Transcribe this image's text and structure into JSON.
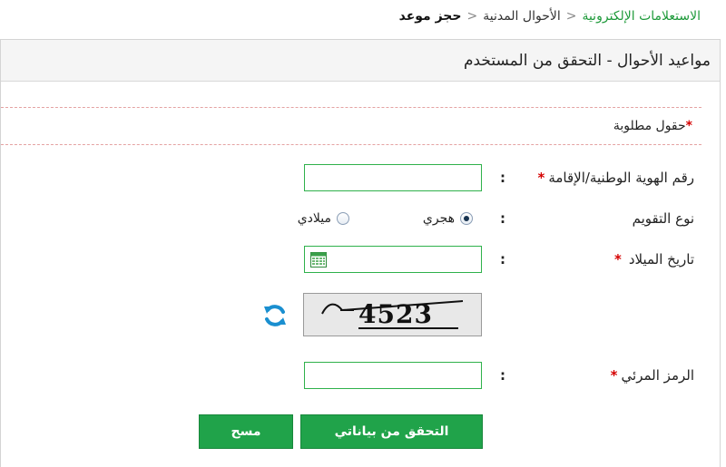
{
  "breadcrumb": {
    "items": [
      "الاستعلامات الإلكترونية",
      "الأحوال المدنية",
      "حجز موعد"
    ]
  },
  "panel": {
    "title": "مواعيد الأحوال - التحقق من المستخدم"
  },
  "required_note": {
    "star": "*",
    "text": "حقول مطلوبة"
  },
  "form": {
    "id_label": "رقم الهوية الوطنية/الإقامة",
    "calendar_label": "نوع التقويم",
    "calendar_options": [
      "هجري",
      "ميلادي"
    ],
    "calendar_selected": "هجري",
    "birth_date_label": "تاريخ الميلاد",
    "visual_code_label": "الرمز المرئي",
    "colon": ":",
    "star": "*",
    "id_value": "",
    "birth_date_value": "",
    "visual_code_value": ""
  },
  "captcha": {
    "text": "4523"
  },
  "buttons": {
    "verify": "التحقق من بياناتي",
    "clear": "مسح"
  },
  "colors": {
    "accent_green": "#20a34a",
    "field_border": "#2fb14b",
    "required_red": "#d50000"
  },
  "icons": [
    "calendar-icon",
    "refresh-icon"
  ]
}
